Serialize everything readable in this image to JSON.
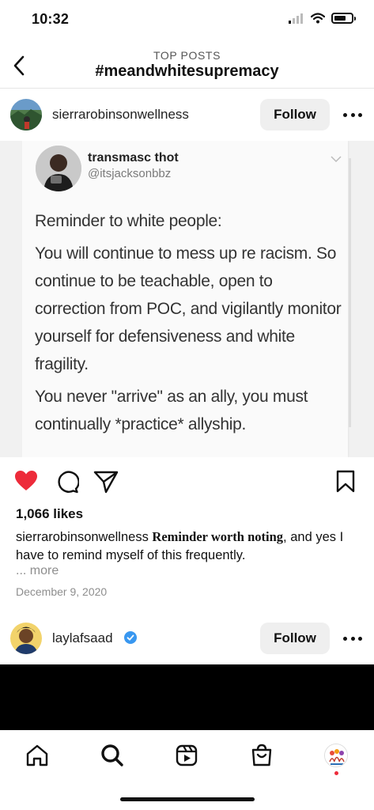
{
  "status_bar": {
    "time": "10:32"
  },
  "header": {
    "subtitle": "TOP POSTS",
    "title": "#meandwhitesupremacy"
  },
  "post1": {
    "username": "sierrarobinsonwellness",
    "follow_label": "Follow",
    "tweet": {
      "name": "transmasc thot",
      "handle": "@itsjacksonbbz",
      "paragraphs": [
        "Reminder to white people:",
        "You will continue to mess up re racism. So continue to be teachable, open to correction from POC, and vigilantly monitor yourself for defensiveness and white fragility.",
        "You never \"arrive\" as an ally, you must continually *practice* allyship."
      ]
    },
    "likes": "1,066 likes",
    "caption_user": "sierrarobinsonwellness",
    "caption_styled": "Reminder worth noting",
    "caption_rest": ", and yes I have to remind myself of this frequently.",
    "more_label": "... more",
    "date": "December 9, 2020",
    "liked": true,
    "like_color": "#ed2b3a"
  },
  "post2": {
    "username": "laylafsaad",
    "verified": true,
    "verified_color": "#3897f0",
    "follow_label": "Follow"
  },
  "tabbar": {
    "items": [
      "home-icon",
      "search-icon",
      "reels-icon",
      "shop-icon",
      "profile-avatar"
    ],
    "notification_color": "#ed2b3a"
  }
}
